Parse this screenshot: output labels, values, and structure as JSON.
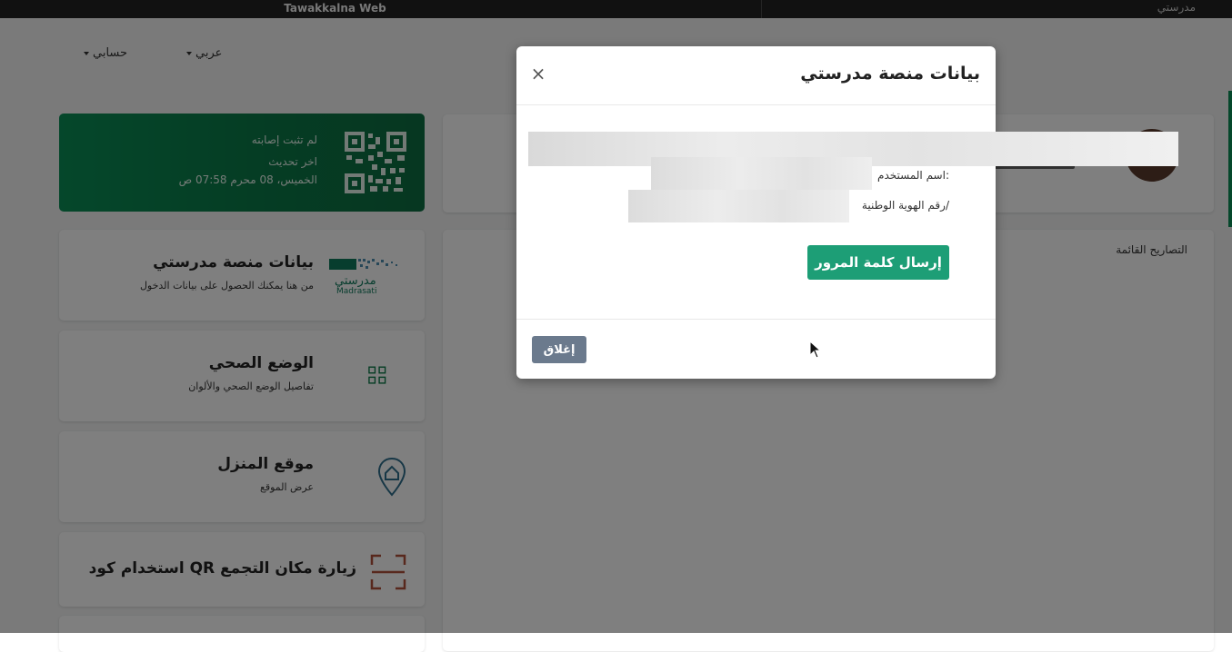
{
  "window": {
    "tab_title": "Tawakkalna Web",
    "tab_right_label": "مدرستي"
  },
  "nav": {
    "language": "عربي",
    "account": "حسابي"
  },
  "status_card": {
    "line1": "لم تثبت إصابته",
    "line2": "اخر تحديث",
    "line3": "الخميس، 08 محرم 07:58 ص",
    "bg_color": "#0a8f56"
  },
  "service_cards": [
    {
      "title": "بيانات منصة مدرستي",
      "subtitle": "من هنا يمكنك الحصول على بيانات الدخول",
      "icon": "madrasati-logo",
      "icon_text": "Madrasati"
    },
    {
      "title": "الوضع الصحي",
      "subtitle": "تفاصيل الوضع الصحي والألوان",
      "icon": "qr-grid-icon"
    },
    {
      "title": "موقع المنزل",
      "subtitle": "عرض الموقع",
      "icon": "home-location-icon"
    },
    {
      "title": "استخدام كود QR زيارة مكان التجمع",
      "icon": "qr-scan-icon"
    }
  ],
  "permits": {
    "title": "التصاريح القائمة"
  },
  "modal": {
    "title": "بيانات منصة مدرستي",
    "username_label": "اسم المستخدم:",
    "national_id_label": "رقم الهوية الوطنية/",
    "send_password_button": "إرسال كلمة المرور",
    "close_button": "إغلاق",
    "close_icon": "×"
  },
  "colors": {
    "brand_green": "#0a8f56",
    "send_button": "#1d9e76",
    "close_button": "#6b7a8d"
  }
}
